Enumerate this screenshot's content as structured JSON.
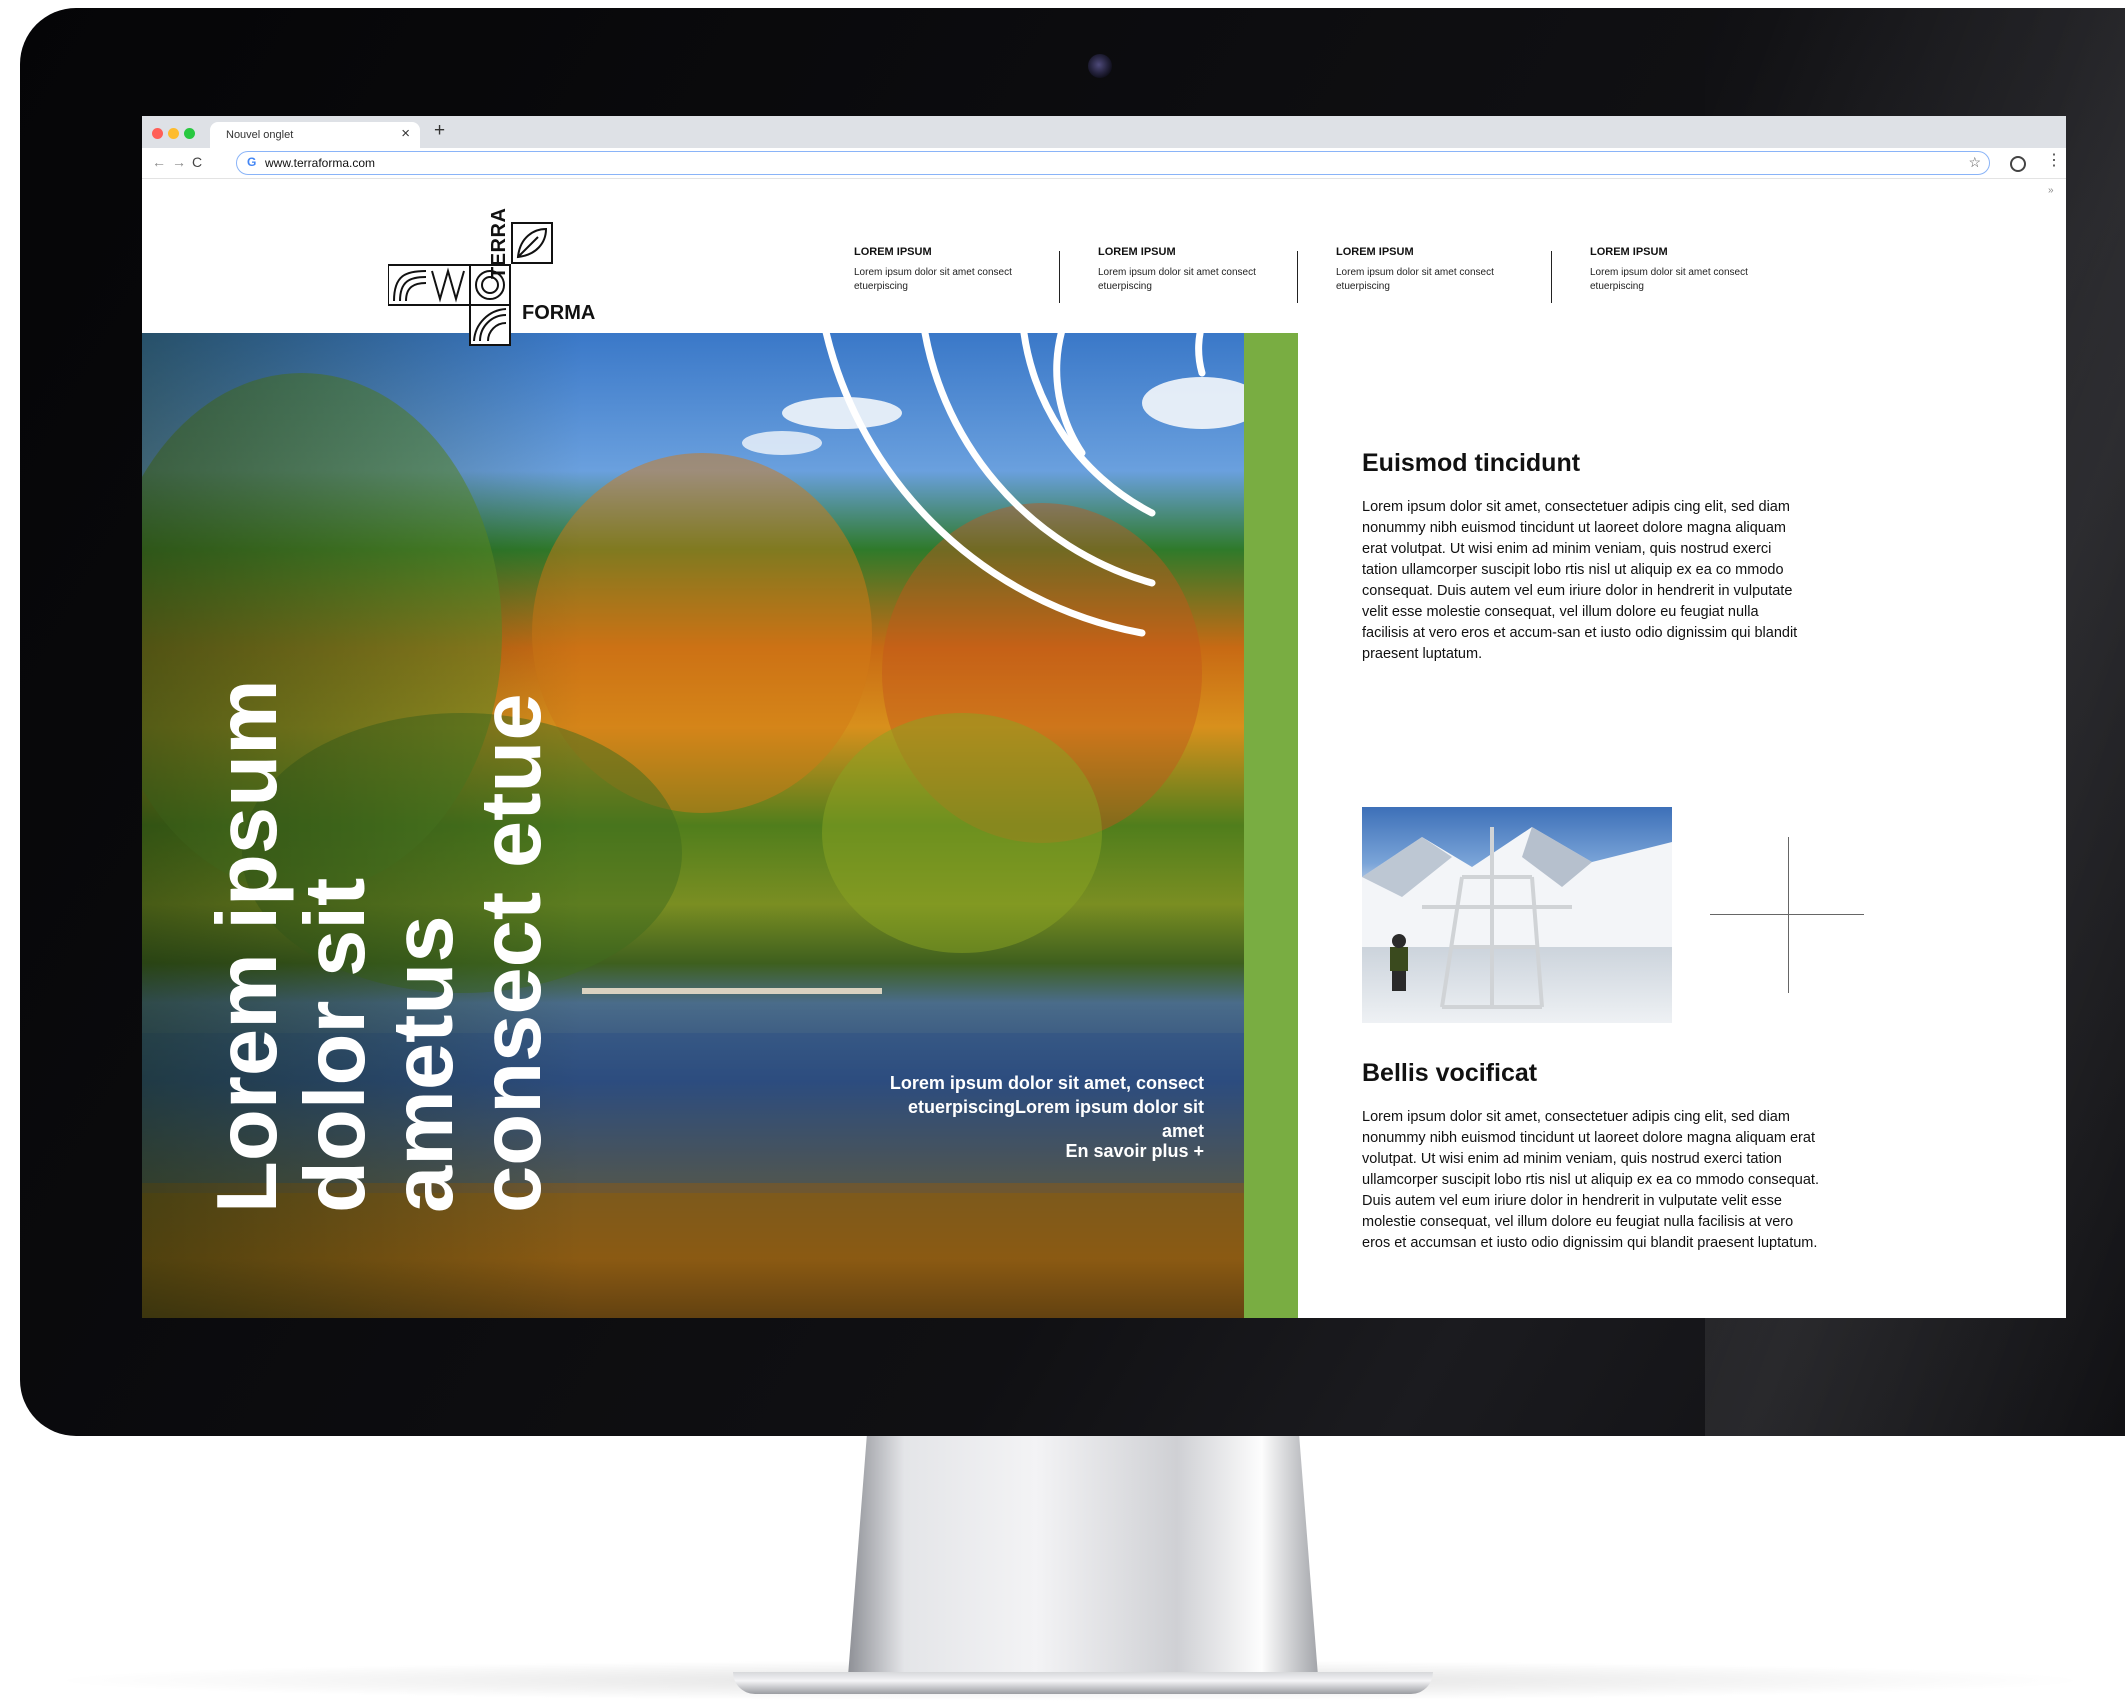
{
  "browser": {
    "tab_title": "Nouvel onglet",
    "tab_close": "×",
    "new_tab": "+",
    "back": "←",
    "forward": "→",
    "reload": "C",
    "google_mark": "G",
    "url": "www.terraforma.com",
    "star": "☆",
    "menu": "⋮",
    "extension": "»"
  },
  "logo": {
    "word_top": "TERRA",
    "word_right": "FORMA"
  },
  "nav": [
    {
      "heading": "LOREM IPSUM",
      "text": "Lorem ipsum dolor sit amet consect etuerpiscing"
    },
    {
      "heading": "LOREM IPSUM",
      "text": "Lorem ipsum dolor sit amet consect etuerpiscing"
    },
    {
      "heading": "LOREM IPSUM",
      "text": "Lorem ipsum dolor sit amet consect etuerpiscing"
    },
    {
      "heading": "LOREM IPSUM",
      "text": "Lorem ipsum dolor sit amet consect etuerpiscing"
    }
  ],
  "hero": {
    "title": "Lorem ipsum dolor sit ametus consect etue",
    "caption": "Lorem ipsum dolor sit amet, consect etuerpiscingLorem ipsum dolor sit amet",
    "cta": "En savoir plus +"
  },
  "articles": [
    {
      "title": "Euismod tincidunt",
      "text": "Lorem ipsum dolor sit amet, consectetuer adipis cing elit, sed diam nonummy nibh euismod tincidunt ut laoreet dolore magna aliquam erat volutpat. Ut wisi enim ad minim veniam, quis nostrud exerci tation ullamcorper suscipit lobo rtis nisl ut aliquip ex ea co mmodo consequat. Duis autem vel eum iriure dolor in hendrerit in vulputate velit esse molestie consequat, vel illum dolore eu feugiat nulla facilisis at vero eros et accum-san et iusto odio dignissim qui blandit praesent luptatum."
    },
    {
      "title": "Bellis vocificat",
      "text": "Lorem ipsum dolor sit amet, consectetuer adipis cing elit, sed diam nonummy nibh euismod tincidunt ut laoreet dolore magna aliquam erat volutpat. Ut wisi enim ad minim veniam, quis nostrud exerci tation ullamcorper suscipit lobo rtis nisl ut aliquip ex ea co mmodo consequat. Duis autem vel eum iriure dolor in hendrerit in vulputate velit esse molestie consequat, vel illum dolore eu feugiat nulla facilisis at vero eros et accumsan et iusto odio dignissim qui blandit praesent luptatum."
    }
  ],
  "colors": {
    "accent_green": "#79ad42",
    "monitor_bezel": "#0a0a0c",
    "hero_text": "#ffffff"
  },
  "icons": [
    "back-arrow-icon",
    "forward-arrow-icon",
    "reload-icon",
    "google-icon",
    "star-icon",
    "profile-icon",
    "menu-icon",
    "leaf-icon",
    "camera-icon"
  ]
}
